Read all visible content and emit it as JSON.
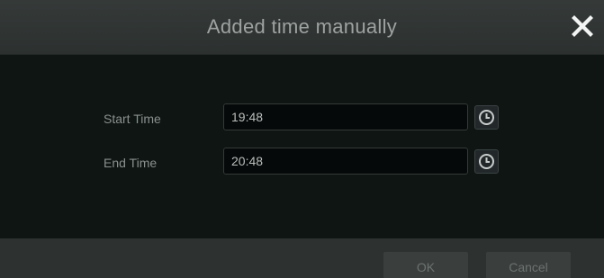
{
  "dialog": {
    "title": "Added time manually",
    "close_icon": "close-icon"
  },
  "fields": {
    "start_time": {
      "label": "Start Time",
      "value": "19:48",
      "icon": "clock-icon"
    },
    "end_time": {
      "label": "End Time",
      "value": "20:48",
      "icon": "clock-icon"
    }
  },
  "footer": {
    "ok_label": "OK",
    "cancel_label": "Cancel"
  }
}
